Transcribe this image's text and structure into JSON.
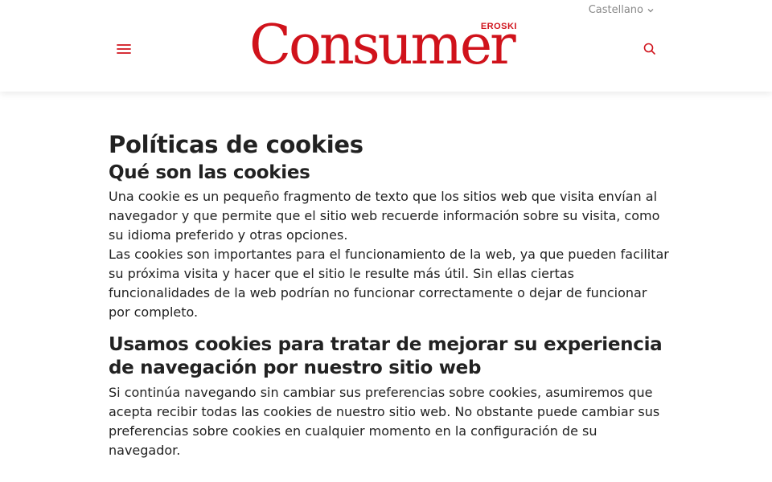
{
  "header": {
    "language": "Castellano",
    "menu_icon": "hamburger-menu-icon",
    "search_icon": "search-icon",
    "logo": {
      "word": "Consumer",
      "brand": "EROSKI"
    },
    "colors": {
      "brand_red": "#d0121b",
      "lang_text": "#888888"
    }
  },
  "main": {
    "title": "Políticas de cookies",
    "sections": [
      {
        "heading": "Qué son las cookies",
        "paragraphs": [
          "Una cookie es un pequeño fragmento de texto que los sitios web que visita envían al navegador y que permite que el sitio web recuerde información sobre su visita, como su idioma preferido y otras opciones.",
          "Las cookies son importantes para el funcionamiento de la web, ya que pueden facilitar su próxima visita y hacer que el sitio le resulte más útil. Sin ellas ciertas funcionalidades de la web podrían no funcionar correctamente o dejar de funcionar por completo."
        ]
      },
      {
        "heading": "Usamos cookies para tratar de mejorar su experiencia de navegación por nuestro sitio web",
        "paragraphs": [
          "Si continúa navegando sin cambiar sus preferencias sobre cookies, asumiremos que acepta recibir todas las cookies de nuestro sitio web. No obstante puede cambiar sus preferencias sobre cookies en cualquier momento en la configuración de su navegador."
        ]
      }
    ]
  }
}
